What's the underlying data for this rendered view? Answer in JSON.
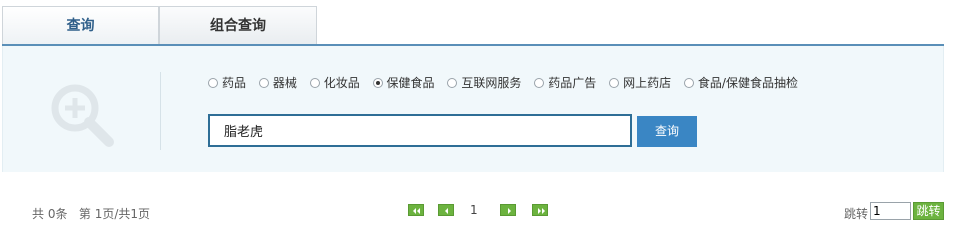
{
  "tabs": [
    {
      "label": "查询",
      "active": true
    },
    {
      "label": "组合查询",
      "active": false
    }
  ],
  "search": {
    "categories": [
      {
        "label": "药品",
        "checked": false
      },
      {
        "label": "器械",
        "checked": false
      },
      {
        "label": "化妆品",
        "checked": false
      },
      {
        "label": "保健食品",
        "checked": true
      },
      {
        "label": "互联网服务",
        "checked": false
      },
      {
        "label": "药品广告",
        "checked": false
      },
      {
        "label": "网上药店",
        "checked": false
      },
      {
        "label": "食品/保健食品抽检",
        "checked": false
      }
    ],
    "query_value": "脂老虎",
    "button_label": "查询",
    "icon": "magnifier-plus-icon"
  },
  "pagination": {
    "total_text": "共 0条",
    "page_text": "第 1页/共1页",
    "current_page": "1",
    "jump_label": "跳转",
    "jump_value": "1",
    "jump_button": "跳转",
    "icons": [
      "first-page-icon",
      "prev-page-icon",
      "next-page-icon",
      "last-page-icon"
    ]
  },
  "colors": {
    "accent": "#5a8fb8",
    "button_blue": "#3a86c4",
    "pager_green": "#6cb33f",
    "panel_bg": "#f1f8fb"
  }
}
